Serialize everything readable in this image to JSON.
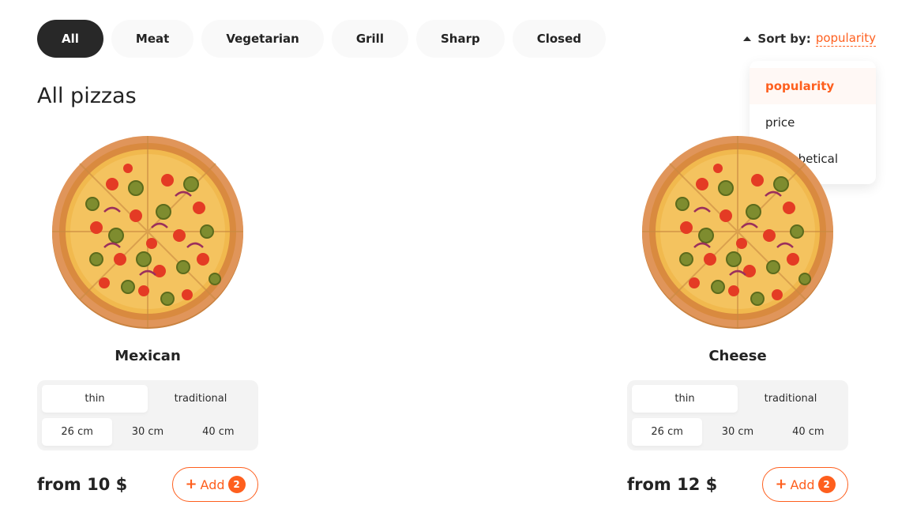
{
  "categories": [
    "All",
    "Meat",
    "Vegetarian",
    "Grill",
    "Sharp",
    "Closed"
  ],
  "sort": {
    "label": "Sort by:",
    "value": "popularity",
    "options": [
      "popularity",
      "price",
      "alphabetical"
    ]
  },
  "title": "All pizzas",
  "pizzas": [
    {
      "name": "Mexican",
      "types": [
        "thin",
        "traditional"
      ],
      "sizes": [
        "26 cm",
        "30 cm",
        "40 cm"
      ],
      "price": "from 10 $",
      "add_label": "Add",
      "count": "2"
    },
    {
      "name": "Cheese",
      "types": [
        "thin",
        "traditional"
      ],
      "sizes": [
        "26 cm",
        "30 cm",
        "40 cm"
      ],
      "price": "from 12 $",
      "add_label": "Add",
      "count": "2"
    }
  ],
  "colors": {
    "accent": "#fe5f1e",
    "active_pill": "#282828",
    "pill_bg": "#f9f9f9"
  }
}
